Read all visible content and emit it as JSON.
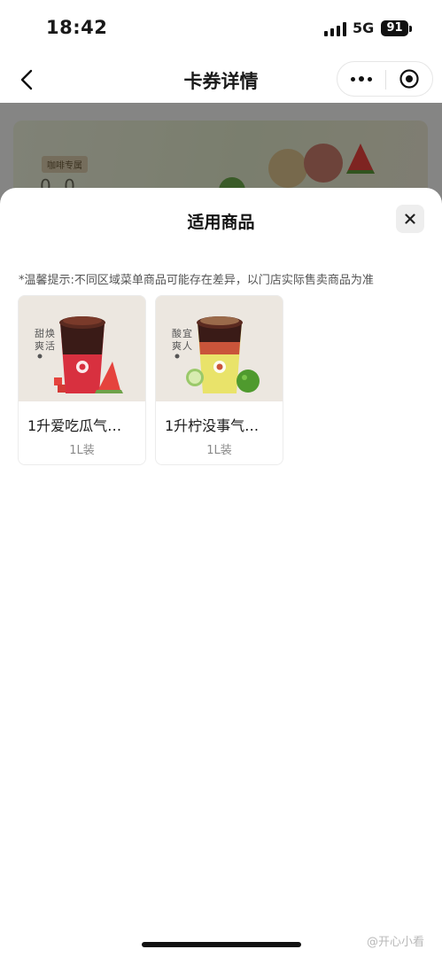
{
  "status_bar": {
    "time": "18:42",
    "network": "5G",
    "battery": "91"
  },
  "nav": {
    "title": "卡券详情",
    "back_icon": "chevron-left-icon",
    "more_icon": "more-dots-icon",
    "close_icon": "target-circle-icon"
  },
  "background": {
    "banner_tag": "咖啡专属",
    "banner_sub": "0 0"
  },
  "sheet": {
    "title": "适用商品",
    "close_icon": "close-icon",
    "notice": "*温馨提示:不同区域菜单商品可能存在差异，以门店实际售卖商品为准",
    "products": [
      {
        "name": "1升爱吃瓜气…",
        "spec": "1L装",
        "side_text": [
          "甜",
          "爽",
          "焕",
          "活"
        ],
        "drink_color": "#d8303f",
        "fruit": "watermelon"
      },
      {
        "name": "1升柠没事气…",
        "spec": "1L装",
        "side_text": [
          "酸",
          "爽",
          "宜",
          "人"
        ],
        "drink_color": "#e9e36a",
        "fruit": "lime"
      }
    ]
  },
  "watermark": "@开心小看",
  "colors": {
    "overlay": "rgba(0,0,0,0.45)",
    "accent_text": "#111111",
    "muted_text": "#8a8a8a"
  }
}
